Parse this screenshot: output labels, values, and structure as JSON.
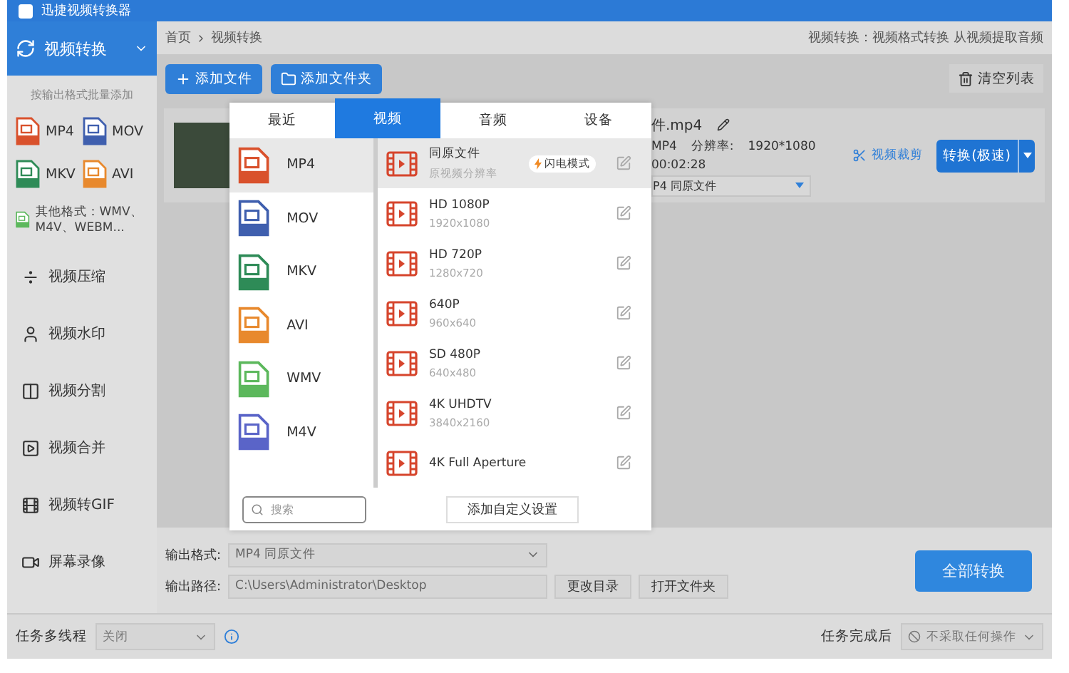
{
  "window": {
    "title": "迅捷视频转换器"
  },
  "sidebar": {
    "active": {
      "label": "视频转换",
      "expanded": true
    },
    "hint": "按输出格式批量添加",
    "formats": [
      {
        "label": "MP4",
        "color": "#d9512c"
      },
      {
        "label": "MOV",
        "color": "#3f5fae"
      },
      {
        "label": "MKV",
        "color": "#2e8b57"
      },
      {
        "label": "AVI",
        "color": "#e8892d"
      }
    ],
    "other_formats": "其他格式：WMV、M4V、WEBM...",
    "items": [
      {
        "label": "视频压缩",
        "kind": "compress"
      },
      {
        "label": "视频水印",
        "kind": "watermark"
      },
      {
        "label": "视频分割",
        "kind": "split"
      },
      {
        "label": "视频合并",
        "kind": "merge"
      },
      {
        "label": "视频转GIF",
        "kind": "gif"
      },
      {
        "label": "屏幕录像",
        "kind": "record"
      }
    ]
  },
  "breadcrumb": {
    "items": [
      "首页",
      "视频转换"
    ],
    "description": "视频转换：视频格式转换 从视频提取音频"
  },
  "toolbar": {
    "add_file": "添加文件",
    "add_folder": "添加文件夹",
    "clear": "清空列表"
  },
  "file": {
    "name": "件.mp4",
    "format": "MP4",
    "resolution_label": "分辨率:",
    "resolution": "1920*1080",
    "duration": "00:02:28",
    "output": "P4  同原文件",
    "crop": "视频裁剪",
    "convert": "转换(极速)"
  },
  "popup": {
    "tabs": [
      {
        "label": "最近",
        "selected": false
      },
      {
        "label": "视频",
        "selected": true
      },
      {
        "label": "音频",
        "selected": false
      },
      {
        "label": "设备",
        "selected": false
      }
    ],
    "formats": [
      {
        "label": "MP4",
        "color": "#d9512c",
        "selected": true
      },
      {
        "label": "MOV",
        "color": "#3f5fae",
        "selected": false
      },
      {
        "label": "MKV",
        "color": "#2e8b57",
        "selected": false
      },
      {
        "label": "AVI",
        "color": "#e8892d",
        "selected": false
      },
      {
        "label": "WMV",
        "color": "#5cb85c",
        "selected": false
      },
      {
        "label": "M4V",
        "color": "#5a64c8",
        "selected": false
      }
    ],
    "presets": [
      {
        "name": "同原文件",
        "resolution": "原视频分辨率",
        "badge": "闪电模式",
        "selected": true
      },
      {
        "name": "HD 1080P",
        "resolution": "1920x1080",
        "selected": false
      },
      {
        "name": "HD 720P",
        "resolution": "1280x720",
        "selected": false
      },
      {
        "name": "640P",
        "resolution": "960x640",
        "selected": false
      },
      {
        "name": "SD 480P",
        "resolution": "640x480",
        "selected": false
      },
      {
        "name": "4K UHDTV",
        "resolution": "3840x2160",
        "selected": false
      },
      {
        "name": "4K Full Aperture",
        "selected": false
      }
    ],
    "search": {
      "placeholder": "搜索"
    },
    "custom": "添加自定义设置"
  },
  "output": {
    "format_label": "输出格式:",
    "format": "MP4  同原文件",
    "path_label": "输出路径:",
    "path": "C:\\Users\\Administrator\\Desktop",
    "change_dir": "更改目录",
    "open_folder": "打开文件夹",
    "convert_all": "全部转换"
  },
  "footer": {
    "threads_label": "任务多线程",
    "threads": "关闭",
    "after_label": "任务完成后",
    "after": "不采取任何操作"
  }
}
